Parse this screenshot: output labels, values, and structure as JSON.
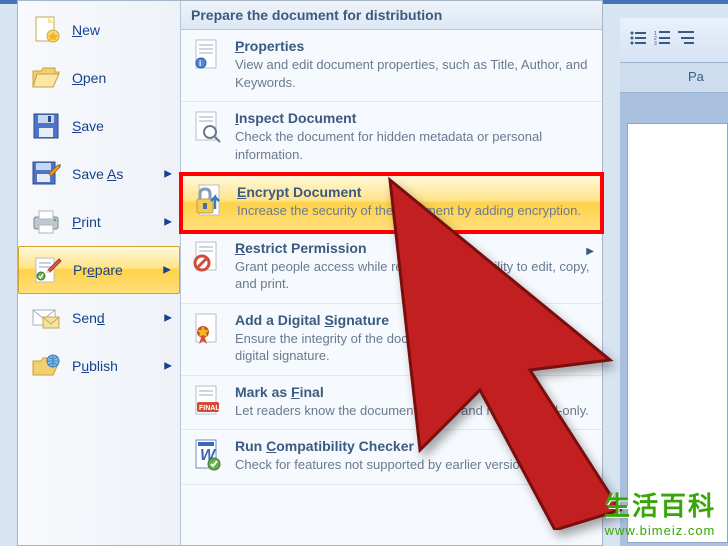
{
  "panel_header": "Prepare the document for distribution",
  "left": {
    "items": [
      {
        "label_pre": "",
        "u": "N",
        "label_post": "ew"
      },
      {
        "label_pre": "",
        "u": "O",
        "label_post": "pen"
      },
      {
        "label_pre": "",
        "u": "S",
        "label_post": "ave"
      },
      {
        "label_pre": "Save ",
        "u": "A",
        "label_post": "s"
      },
      {
        "label_pre": "",
        "u": "P",
        "label_post": "rint"
      },
      {
        "label_pre": "Pr",
        "u": "e",
        "label_post": "pare"
      },
      {
        "label_pre": "Sen",
        "u": "d",
        "label_post": ""
      },
      {
        "label_pre": "P",
        "u": "u",
        "label_post": "blish"
      }
    ]
  },
  "right": {
    "items": [
      {
        "title_pre": "",
        "u": "P",
        "title_post": "roperties",
        "desc": "View and edit document properties, such as Title, Author, and Keywords."
      },
      {
        "title_pre": "",
        "u": "I",
        "title_post": "nspect Document",
        "desc": "Check the document for hidden metadata or personal information."
      },
      {
        "title_pre": "",
        "u": "E",
        "title_post": "ncrypt Document",
        "desc": "Increase the security of the document by adding encryption."
      },
      {
        "title_pre": "",
        "u": "R",
        "title_post": "estrict Permission",
        "desc": "Grant people access while restricting their ability to edit, copy, and print."
      },
      {
        "title_pre": "Add a Digital ",
        "u": "S",
        "title_post": "ignature",
        "desc": "Ensure the integrity of the document by adding an invisible digital signature."
      },
      {
        "title_pre": "Mark as ",
        "u": "F",
        "title_post": "inal",
        "desc": "Let readers know the document is final and make it read-only."
      },
      {
        "title_pre": "Run ",
        "u": "C",
        "title_post": "ompatibility Checker",
        "desc": "Check for features not supported by earlier versions of Word."
      }
    ]
  },
  "tab_label": "Pa",
  "watermark": {
    "zh": "生活百科",
    "url": "www.bimeiz.com"
  }
}
